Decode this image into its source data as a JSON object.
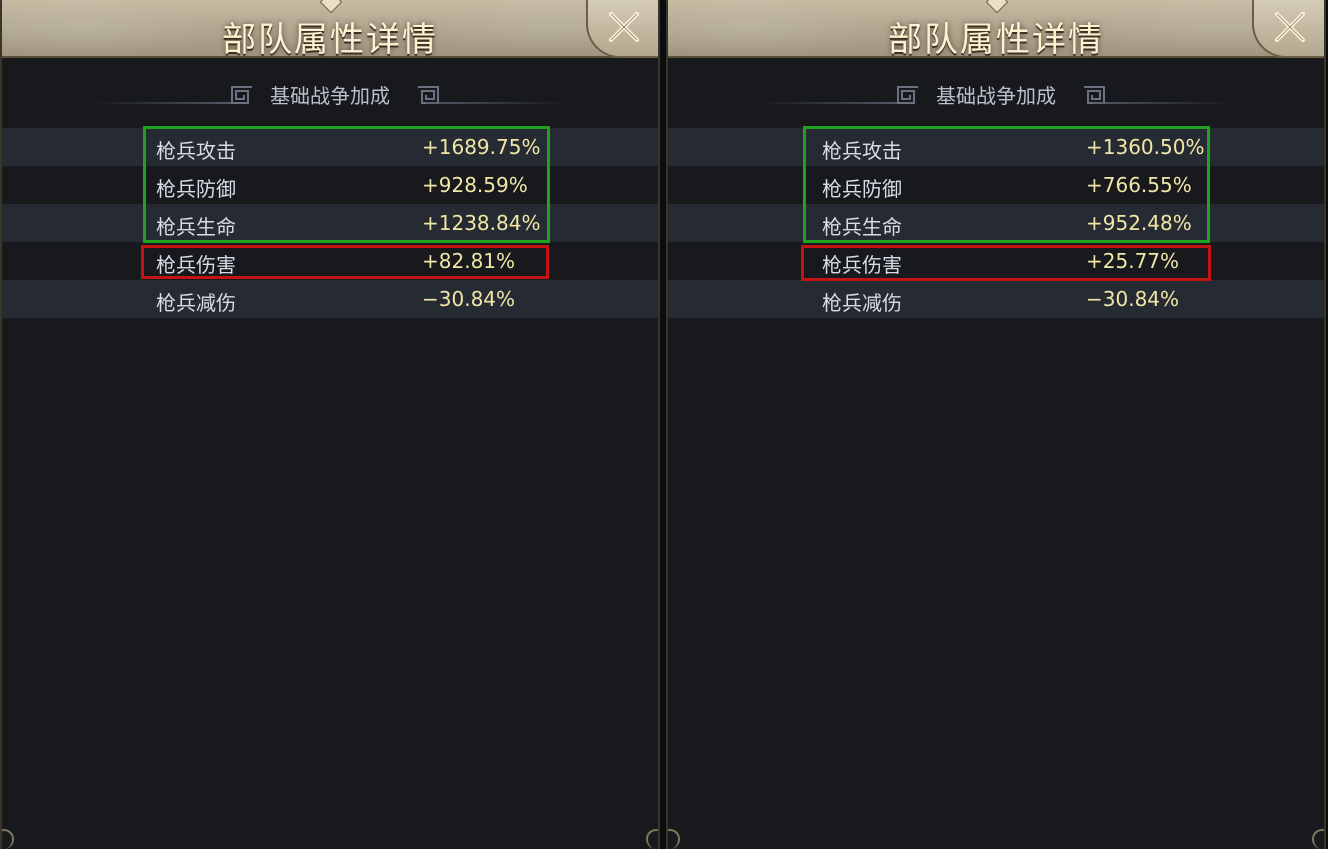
{
  "panels": [
    {
      "title": "部队属性详情",
      "section_title": "基础战争加成",
      "rows": [
        {
          "label": "枪兵攻击",
          "value": "+1689.75%"
        },
        {
          "label": "枪兵防御",
          "value": "+928.59%"
        },
        {
          "label": "枪兵生命",
          "value": "+1238.84%"
        },
        {
          "label": "枪兵伤害",
          "value": "+82.81%"
        },
        {
          "label": "枪兵减伤",
          "value": "−30.84%"
        }
      ]
    },
    {
      "title": "部队属性详情",
      "section_title": "基础战争加成",
      "rows": [
        {
          "label": "枪兵攻击",
          "value": "+1360.50%"
        },
        {
          "label": "枪兵防御",
          "value": "+766.55%"
        },
        {
          "label": "枪兵生命",
          "value": "+952.48%"
        },
        {
          "label": "枪兵伤害",
          "value": "+25.77%"
        },
        {
          "label": "枪兵减伤",
          "value": "−30.84%"
        }
      ]
    }
  ],
  "icons": {
    "close": "close-icon",
    "section_ornament": "key-pattern-icon"
  },
  "colors": {
    "highlight_group": "#1fa21f",
    "highlight_single": "#c41313",
    "value_text": "#f0e6a6"
  }
}
